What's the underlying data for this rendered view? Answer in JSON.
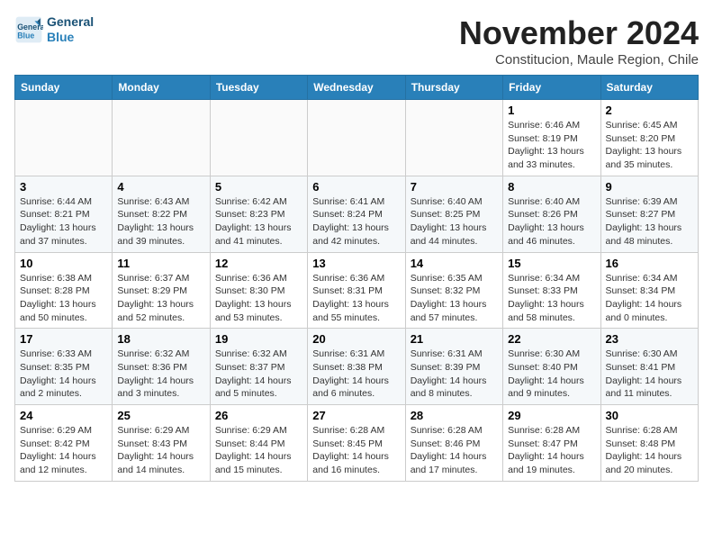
{
  "logo": {
    "line1": "General",
    "line2": "Blue"
  },
  "title": "November 2024",
  "location": "Constitucion, Maule Region, Chile",
  "days_of_week": [
    "Sunday",
    "Monday",
    "Tuesday",
    "Wednesday",
    "Thursday",
    "Friday",
    "Saturday"
  ],
  "weeks": [
    [
      {
        "day": "",
        "info": ""
      },
      {
        "day": "",
        "info": ""
      },
      {
        "day": "",
        "info": ""
      },
      {
        "day": "",
        "info": ""
      },
      {
        "day": "",
        "info": ""
      },
      {
        "day": "1",
        "info": "Sunrise: 6:46 AM\nSunset: 8:19 PM\nDaylight: 13 hours and 33 minutes."
      },
      {
        "day": "2",
        "info": "Sunrise: 6:45 AM\nSunset: 8:20 PM\nDaylight: 13 hours and 35 minutes."
      }
    ],
    [
      {
        "day": "3",
        "info": "Sunrise: 6:44 AM\nSunset: 8:21 PM\nDaylight: 13 hours and 37 minutes."
      },
      {
        "day": "4",
        "info": "Sunrise: 6:43 AM\nSunset: 8:22 PM\nDaylight: 13 hours and 39 minutes."
      },
      {
        "day": "5",
        "info": "Sunrise: 6:42 AM\nSunset: 8:23 PM\nDaylight: 13 hours and 41 minutes."
      },
      {
        "day": "6",
        "info": "Sunrise: 6:41 AM\nSunset: 8:24 PM\nDaylight: 13 hours and 42 minutes."
      },
      {
        "day": "7",
        "info": "Sunrise: 6:40 AM\nSunset: 8:25 PM\nDaylight: 13 hours and 44 minutes."
      },
      {
        "day": "8",
        "info": "Sunrise: 6:40 AM\nSunset: 8:26 PM\nDaylight: 13 hours and 46 minutes."
      },
      {
        "day": "9",
        "info": "Sunrise: 6:39 AM\nSunset: 8:27 PM\nDaylight: 13 hours and 48 minutes."
      }
    ],
    [
      {
        "day": "10",
        "info": "Sunrise: 6:38 AM\nSunset: 8:28 PM\nDaylight: 13 hours and 50 minutes."
      },
      {
        "day": "11",
        "info": "Sunrise: 6:37 AM\nSunset: 8:29 PM\nDaylight: 13 hours and 52 minutes."
      },
      {
        "day": "12",
        "info": "Sunrise: 6:36 AM\nSunset: 8:30 PM\nDaylight: 13 hours and 53 minutes."
      },
      {
        "day": "13",
        "info": "Sunrise: 6:36 AM\nSunset: 8:31 PM\nDaylight: 13 hours and 55 minutes."
      },
      {
        "day": "14",
        "info": "Sunrise: 6:35 AM\nSunset: 8:32 PM\nDaylight: 13 hours and 57 minutes."
      },
      {
        "day": "15",
        "info": "Sunrise: 6:34 AM\nSunset: 8:33 PM\nDaylight: 13 hours and 58 minutes."
      },
      {
        "day": "16",
        "info": "Sunrise: 6:34 AM\nSunset: 8:34 PM\nDaylight: 14 hours and 0 minutes."
      }
    ],
    [
      {
        "day": "17",
        "info": "Sunrise: 6:33 AM\nSunset: 8:35 PM\nDaylight: 14 hours and 2 minutes."
      },
      {
        "day": "18",
        "info": "Sunrise: 6:32 AM\nSunset: 8:36 PM\nDaylight: 14 hours and 3 minutes."
      },
      {
        "day": "19",
        "info": "Sunrise: 6:32 AM\nSunset: 8:37 PM\nDaylight: 14 hours and 5 minutes."
      },
      {
        "day": "20",
        "info": "Sunrise: 6:31 AM\nSunset: 8:38 PM\nDaylight: 14 hours and 6 minutes."
      },
      {
        "day": "21",
        "info": "Sunrise: 6:31 AM\nSunset: 8:39 PM\nDaylight: 14 hours and 8 minutes."
      },
      {
        "day": "22",
        "info": "Sunrise: 6:30 AM\nSunset: 8:40 PM\nDaylight: 14 hours and 9 minutes."
      },
      {
        "day": "23",
        "info": "Sunrise: 6:30 AM\nSunset: 8:41 PM\nDaylight: 14 hours and 11 minutes."
      }
    ],
    [
      {
        "day": "24",
        "info": "Sunrise: 6:29 AM\nSunset: 8:42 PM\nDaylight: 14 hours and 12 minutes."
      },
      {
        "day": "25",
        "info": "Sunrise: 6:29 AM\nSunset: 8:43 PM\nDaylight: 14 hours and 14 minutes."
      },
      {
        "day": "26",
        "info": "Sunrise: 6:29 AM\nSunset: 8:44 PM\nDaylight: 14 hours and 15 minutes."
      },
      {
        "day": "27",
        "info": "Sunrise: 6:28 AM\nSunset: 8:45 PM\nDaylight: 14 hours and 16 minutes."
      },
      {
        "day": "28",
        "info": "Sunrise: 6:28 AM\nSunset: 8:46 PM\nDaylight: 14 hours and 17 minutes."
      },
      {
        "day": "29",
        "info": "Sunrise: 6:28 AM\nSunset: 8:47 PM\nDaylight: 14 hours and 19 minutes."
      },
      {
        "day": "30",
        "info": "Sunrise: 6:28 AM\nSunset: 8:48 PM\nDaylight: 14 hours and 20 minutes."
      }
    ]
  ]
}
